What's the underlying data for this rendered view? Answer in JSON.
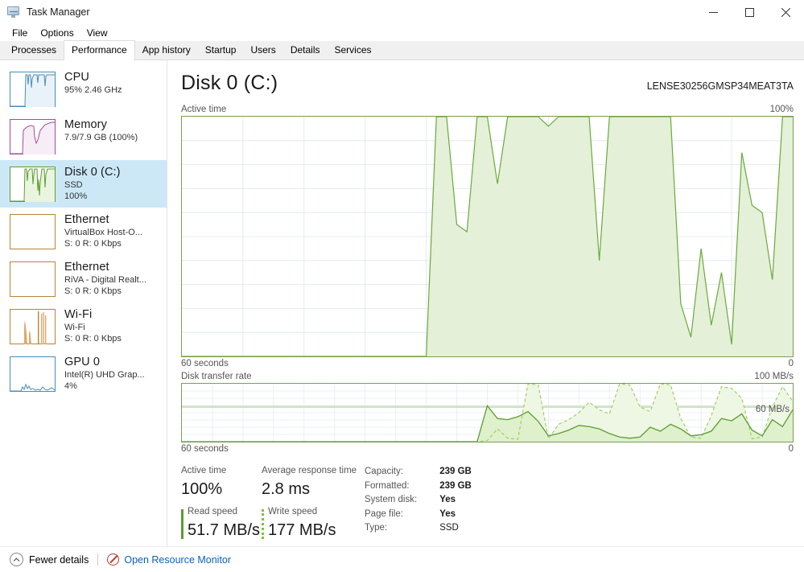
{
  "window": {
    "title": "Task Manager",
    "icon": "task-manager-icon",
    "minimize": "─",
    "maximize": "□",
    "close": "×"
  },
  "menu": [
    {
      "label": "File"
    },
    {
      "label": "Options"
    },
    {
      "label": "View"
    }
  ],
  "tabs": [
    {
      "label": "Processes",
      "active": false
    },
    {
      "label": "Performance",
      "active": true
    },
    {
      "label": "App history",
      "active": false
    },
    {
      "label": "Startup",
      "active": false
    },
    {
      "label": "Users",
      "active": false
    },
    {
      "label": "Details",
      "active": false
    },
    {
      "label": "Services",
      "active": false
    }
  ],
  "sidebar": {
    "items": [
      {
        "title": "CPU",
        "sub1": "95%  2.46 GHz",
        "sub2": "",
        "color": "#4a8cb5",
        "selected": false
      },
      {
        "title": "Memory",
        "sub1": "7.9/7.9 GB (100%)",
        "sub2": "",
        "color": "#9b4f96",
        "selected": false
      },
      {
        "title": "Disk 0 (C:)",
        "sub1": "SSD",
        "sub2": "100%",
        "color": "#5a9e2f",
        "selected": true
      },
      {
        "title": "Ethernet",
        "sub1": "VirtualBox Host-O...",
        "sub2": "S: 0 R: 0 Kbps",
        "color": "#b5843a",
        "selected": false
      },
      {
        "title": "Ethernet",
        "sub1": "RiVA - Digital Realt...",
        "sub2": "S: 0 R: 0 Kbps",
        "color": "#b5843a",
        "selected": false
      },
      {
        "title": "Wi-Fi",
        "sub1": "Wi-Fi",
        "sub2": "S: 0 R: 0 Kbps",
        "color": "#b5843a",
        "selected": false
      },
      {
        "title": "GPU 0",
        "sub1": "Intel(R) UHD Grap...",
        "sub2": "4%",
        "color": "#4a8cb5",
        "selected": false
      }
    ]
  },
  "main": {
    "title": "Disk 0 (C:)",
    "model": "LENSE30256GMSP34MEAT3TA",
    "active_time_chart": {
      "label": "Active time",
      "max_label": "100%",
      "x_label": "60 seconds",
      "x_right_label": "0"
    },
    "transfer_chart": {
      "label": "Disk transfer rate",
      "max_label": "100 MB/s",
      "inline_label": "60 MB/s",
      "x_label": "60 seconds",
      "x_right_label": "0"
    },
    "stats": {
      "active_time_label": "Active time",
      "active_time_value": "100%",
      "response_label": "Average response time",
      "response_value": "2.8 ms",
      "read_label": "Read speed",
      "read_value": "51.7 MB/s",
      "write_label": "Write speed",
      "write_value": "177 MB/s"
    },
    "details": [
      {
        "key": "Capacity:",
        "value": "239 GB"
      },
      {
        "key": "Formatted:",
        "value": "239 GB"
      },
      {
        "key": "System disk:",
        "value": "Yes"
      },
      {
        "key": "Page file:",
        "value": "Yes"
      },
      {
        "key": "Type:",
        "value": "SSD"
      }
    ]
  },
  "footer": {
    "fewer_details": "Fewer details",
    "resource_monitor": "Open Resource Monitor"
  },
  "colors": {
    "accent_green": "#5a9e2f",
    "fill_green": "#e4f0d8",
    "border_green": "#7a9e51",
    "write_green": "#8cc63f",
    "selection_blue": "#cce8f7",
    "link_blue": "#0b62b8"
  },
  "chart_data": [
    {
      "type": "area",
      "title": "Active time",
      "ylabel": "",
      "xlabel": "60 seconds",
      "ylim": [
        0,
        100
      ],
      "xlim": [
        0,
        60
      ],
      "grid": true,
      "series": [
        {
          "name": "Active time",
          "x": [
            0,
            1,
            2,
            3,
            4,
            5,
            6,
            7,
            8,
            9,
            10,
            11,
            12,
            13,
            14,
            15,
            16,
            17,
            18,
            19,
            20,
            21,
            22,
            23,
            24,
            25,
            26,
            27,
            28,
            29,
            30,
            31,
            32,
            33,
            34,
            35,
            36,
            37,
            38,
            39,
            40,
            41,
            42,
            43,
            44,
            45,
            46,
            47,
            48,
            49,
            50,
            51,
            52,
            53,
            54,
            55,
            56,
            57,
            58,
            59,
            60
          ],
          "values": [
            0,
            0,
            0,
            0,
            0,
            0,
            0,
            0,
            0,
            0,
            0,
            0,
            0,
            0,
            0,
            0,
            0,
            0,
            0,
            0,
            0,
            0,
            0,
            0,
            0,
            100,
            100,
            55,
            52,
            100,
            100,
            72,
            100,
            100,
            100,
            100,
            96,
            100,
            100,
            100,
            100,
            40,
            100,
            100,
            100,
            100,
            100,
            100,
            100,
            22,
            8,
            45,
            13,
            35,
            5,
            85,
            63,
            60,
            32,
            100,
            100
          ]
        }
      ]
    },
    {
      "type": "line",
      "title": "Disk transfer rate",
      "ylabel": "MB/s",
      "xlabel": "60 seconds",
      "ylim": [
        0,
        100
      ],
      "xlim": [
        0,
        60
      ],
      "grid": true,
      "annotations": [
        "100 MB/s",
        "60 MB/s"
      ],
      "series": [
        {
          "name": "Read speed",
          "style": "solid",
          "values": [
            0,
            0,
            0,
            0,
            0,
            0,
            0,
            0,
            0,
            0,
            0,
            0,
            0,
            0,
            0,
            0,
            0,
            0,
            0,
            0,
            0,
            0,
            0,
            0,
            0,
            0,
            0,
            0,
            0,
            0,
            62,
            40,
            38,
            43,
            52,
            35,
            10,
            14,
            20,
            28,
            26,
            22,
            14,
            8,
            6,
            8,
            25,
            18,
            30,
            22,
            10,
            12,
            18,
            40,
            36,
            48,
            20,
            10,
            38,
            26,
            55
          ]
        },
        {
          "name": "Write speed",
          "style": "dashed",
          "values": [
            0,
            0,
            0,
            0,
            0,
            0,
            0,
            0,
            0,
            0,
            0,
            0,
            0,
            0,
            0,
            0,
            0,
            0,
            0,
            0,
            0,
            0,
            0,
            0,
            0,
            0,
            0,
            0,
            0,
            0,
            2,
            22,
            6,
            4,
            100,
            98,
            5,
            30,
            38,
            50,
            68,
            55,
            48,
            100,
            98,
            60,
            52,
            100,
            98,
            40,
            8,
            6,
            45,
            95,
            92,
            75,
            5,
            8,
            60,
            95,
            70
          ]
        }
      ]
    }
  ]
}
